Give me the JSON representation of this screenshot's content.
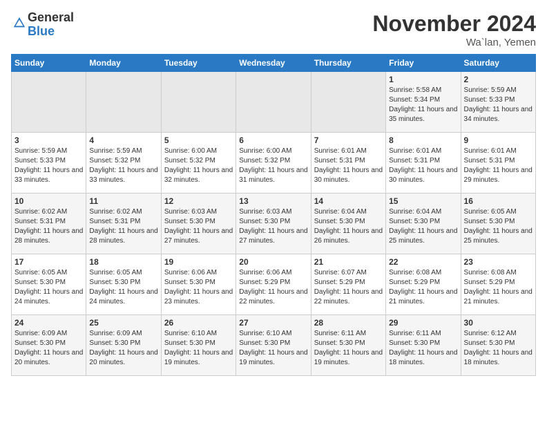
{
  "header": {
    "logo_general": "General",
    "logo_blue": "Blue",
    "month_title": "November 2024",
    "location": "Wa`lan, Yemen"
  },
  "days_of_week": [
    "Sunday",
    "Monday",
    "Tuesday",
    "Wednesday",
    "Thursday",
    "Friday",
    "Saturday"
  ],
  "weeks": [
    [
      {
        "day": "",
        "empty": true
      },
      {
        "day": "",
        "empty": true
      },
      {
        "day": "",
        "empty": true
      },
      {
        "day": "",
        "empty": true
      },
      {
        "day": "",
        "empty": true
      },
      {
        "day": "1",
        "sunrise": "5:58 AM",
        "sunset": "5:34 PM",
        "daylight": "11 hours and 35 minutes."
      },
      {
        "day": "2",
        "sunrise": "5:59 AM",
        "sunset": "5:33 PM",
        "daylight": "11 hours and 34 minutes."
      }
    ],
    [
      {
        "day": "3",
        "sunrise": "5:59 AM",
        "sunset": "5:33 PM",
        "daylight": "11 hours and 33 minutes."
      },
      {
        "day": "4",
        "sunrise": "5:59 AM",
        "sunset": "5:32 PM",
        "daylight": "11 hours and 33 minutes."
      },
      {
        "day": "5",
        "sunrise": "6:00 AM",
        "sunset": "5:32 PM",
        "daylight": "11 hours and 32 minutes."
      },
      {
        "day": "6",
        "sunrise": "6:00 AM",
        "sunset": "5:32 PM",
        "daylight": "11 hours and 31 minutes."
      },
      {
        "day": "7",
        "sunrise": "6:01 AM",
        "sunset": "5:31 PM",
        "daylight": "11 hours and 30 minutes."
      },
      {
        "day": "8",
        "sunrise": "6:01 AM",
        "sunset": "5:31 PM",
        "daylight": "11 hours and 30 minutes."
      },
      {
        "day": "9",
        "sunrise": "6:01 AM",
        "sunset": "5:31 PM",
        "daylight": "11 hours and 29 minutes."
      }
    ],
    [
      {
        "day": "10",
        "sunrise": "6:02 AM",
        "sunset": "5:31 PM",
        "daylight": "11 hours and 28 minutes."
      },
      {
        "day": "11",
        "sunrise": "6:02 AM",
        "sunset": "5:31 PM",
        "daylight": "11 hours and 28 minutes."
      },
      {
        "day": "12",
        "sunrise": "6:03 AM",
        "sunset": "5:30 PM",
        "daylight": "11 hours and 27 minutes."
      },
      {
        "day": "13",
        "sunrise": "6:03 AM",
        "sunset": "5:30 PM",
        "daylight": "11 hours and 27 minutes."
      },
      {
        "day": "14",
        "sunrise": "6:04 AM",
        "sunset": "5:30 PM",
        "daylight": "11 hours and 26 minutes."
      },
      {
        "day": "15",
        "sunrise": "6:04 AM",
        "sunset": "5:30 PM",
        "daylight": "11 hours and 25 minutes."
      },
      {
        "day": "16",
        "sunrise": "6:05 AM",
        "sunset": "5:30 PM",
        "daylight": "11 hours and 25 minutes."
      }
    ],
    [
      {
        "day": "17",
        "sunrise": "6:05 AM",
        "sunset": "5:30 PM",
        "daylight": "11 hours and 24 minutes."
      },
      {
        "day": "18",
        "sunrise": "6:05 AM",
        "sunset": "5:30 PM",
        "daylight": "11 hours and 24 minutes."
      },
      {
        "day": "19",
        "sunrise": "6:06 AM",
        "sunset": "5:30 PM",
        "daylight": "11 hours and 23 minutes."
      },
      {
        "day": "20",
        "sunrise": "6:06 AM",
        "sunset": "5:29 PM",
        "daylight": "11 hours and 22 minutes."
      },
      {
        "day": "21",
        "sunrise": "6:07 AM",
        "sunset": "5:29 PM",
        "daylight": "11 hours and 22 minutes."
      },
      {
        "day": "22",
        "sunrise": "6:08 AM",
        "sunset": "5:29 PM",
        "daylight": "11 hours and 21 minutes."
      },
      {
        "day": "23",
        "sunrise": "6:08 AM",
        "sunset": "5:29 PM",
        "daylight": "11 hours and 21 minutes."
      }
    ],
    [
      {
        "day": "24",
        "sunrise": "6:09 AM",
        "sunset": "5:30 PM",
        "daylight": "11 hours and 20 minutes."
      },
      {
        "day": "25",
        "sunrise": "6:09 AM",
        "sunset": "5:30 PM",
        "daylight": "11 hours and 20 minutes."
      },
      {
        "day": "26",
        "sunrise": "6:10 AM",
        "sunset": "5:30 PM",
        "daylight": "11 hours and 19 minutes."
      },
      {
        "day": "27",
        "sunrise": "6:10 AM",
        "sunset": "5:30 PM",
        "daylight": "11 hours and 19 minutes."
      },
      {
        "day": "28",
        "sunrise": "6:11 AM",
        "sunset": "5:30 PM",
        "daylight": "11 hours and 19 minutes."
      },
      {
        "day": "29",
        "sunrise": "6:11 AM",
        "sunset": "5:30 PM",
        "daylight": "11 hours and 18 minutes."
      },
      {
        "day": "30",
        "sunrise": "6:12 AM",
        "sunset": "5:30 PM",
        "daylight": "11 hours and 18 minutes."
      }
    ]
  ],
  "labels": {
    "sunrise": "Sunrise:",
    "sunset": "Sunset:",
    "daylight": "Daylight:"
  }
}
